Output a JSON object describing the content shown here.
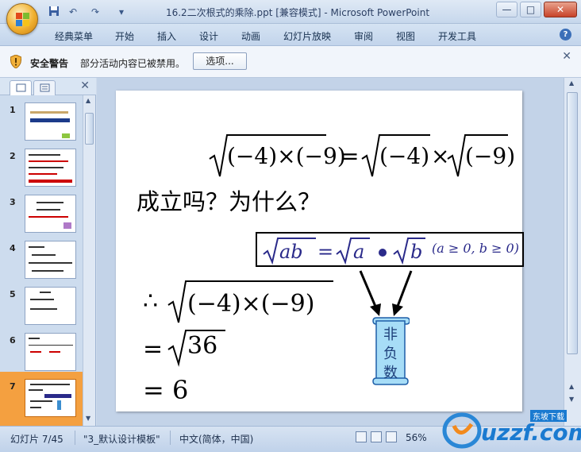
{
  "window": {
    "title": "16.2二次根式的乘除.ppt [兼容模式] - Microsoft PowerPoint",
    "controls": {
      "minimize": "—",
      "maximize": "□",
      "close": "✕"
    }
  },
  "qat": {
    "save_icon": "save-icon",
    "undo": "↶",
    "redo": "↷",
    "more": "▾"
  },
  "ribbon": {
    "tabs": [
      "经典菜单",
      "开始",
      "插入",
      "设计",
      "动画",
      "幻灯片放映",
      "审阅",
      "视图",
      "开发工具"
    ],
    "help": "?"
  },
  "security": {
    "title": "安全警告",
    "message": "部分活动内容已被禁用。",
    "button": "选项...",
    "close": "✕"
  },
  "pane": {
    "close": "✕"
  },
  "thumbnails": [
    {
      "num": "1"
    },
    {
      "num": "2"
    },
    {
      "num": "3"
    },
    {
      "num": "4"
    },
    {
      "num": "5"
    },
    {
      "num": "6"
    },
    {
      "num": "7",
      "selected": true
    }
  ],
  "slide": {
    "question": "成立吗？为什么？",
    "scroll_text": "非负数",
    "condition": "(a ≥ 0, b ≥ 0)",
    "therefore": "∴",
    "eq2_rhs": "36",
    "eq3": "= 6"
  },
  "statusbar": {
    "slide_info": "幻灯片 7/45",
    "template": "\"3_默认设计模板\"",
    "language": "中文(简体，中国)",
    "zoom": "56%"
  },
  "watermark": {
    "text": "uzzf.com",
    "sub": "东坡下载"
  },
  "colors": {
    "selection": "#f4a040",
    "formula_blue": "#2a2a8a",
    "scroll_fill": "#a7ddf7"
  }
}
